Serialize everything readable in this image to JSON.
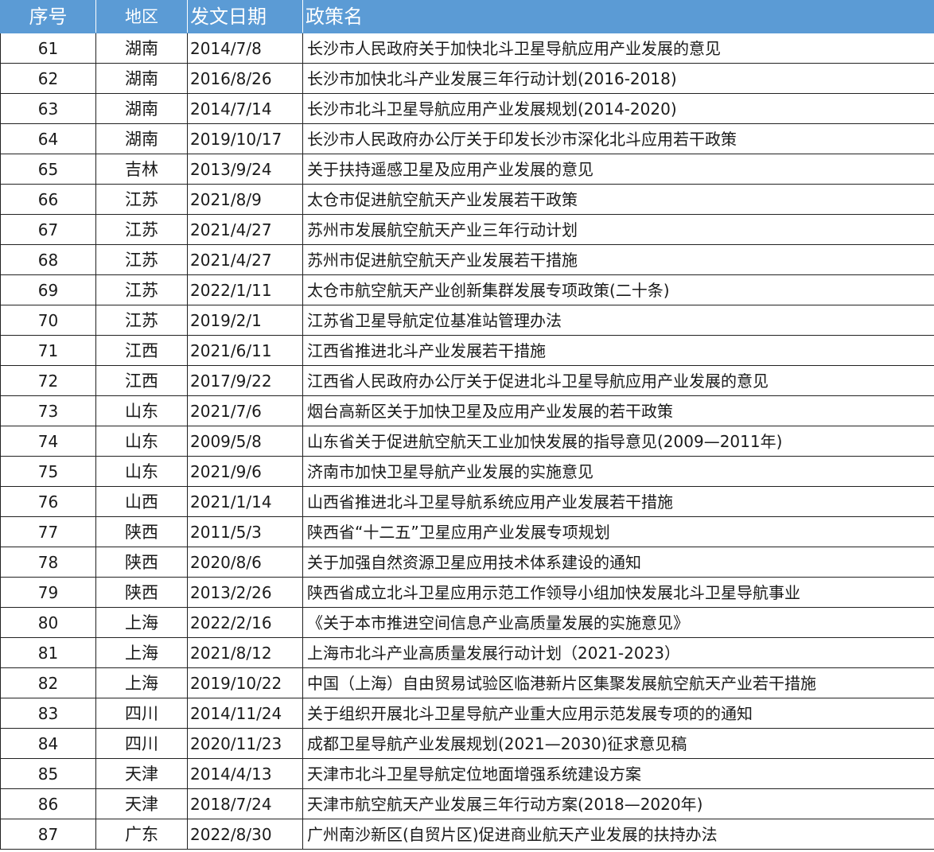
{
  "header": {
    "col_no": "序号",
    "col_region": "地区",
    "col_date": "发文日期",
    "col_name": "政策名"
  },
  "rows": [
    {
      "no": "61",
      "region": "湖南",
      "date": "2014/7/8",
      "name": "长沙市人民政府关于加快北斗卫星导航应用产业发展的意见"
    },
    {
      "no": "62",
      "region": "湖南",
      "date": "2016/8/26",
      "name": "长沙市加快北斗产业发展三年行动计划(2016-2018)"
    },
    {
      "no": "63",
      "region": "湖南",
      "date": "2014/7/14",
      "name": "长沙市北斗卫星导航应用产业发展规划(2014-2020)"
    },
    {
      "no": "64",
      "region": "湖南",
      "date": "2019/10/17",
      "name": "长沙市人民政府办公厅关于印发长沙市深化北斗应用若干政策"
    },
    {
      "no": "65",
      "region": "吉林",
      "date": "2013/9/24",
      "name": "关于扶持遥感卫星及应用产业发展的意见"
    },
    {
      "no": "66",
      "region": "江苏",
      "date": "2021/8/9",
      "name": "太仓市促进航空航天产业发展若干政策"
    },
    {
      "no": "67",
      "region": "江苏",
      "date": "2021/4/27",
      "name": "苏州市发展航空航天产业三年行动计划"
    },
    {
      "no": "68",
      "region": "江苏",
      "date": "2021/4/27",
      "name": "苏州市促进航空航天产业发展若干措施"
    },
    {
      "no": "69",
      "region": "江苏",
      "date": "2022/1/11",
      "name": "太仓市航空航天产业创新集群发展专项政策(二十条)"
    },
    {
      "no": "70",
      "region": "江苏",
      "date": "2019/2/1",
      "name": "江苏省卫星导航定位基准站管理办法"
    },
    {
      "no": "71",
      "region": "江西",
      "date": "2021/6/11",
      "name": "江西省推进北斗产业发展若干措施"
    },
    {
      "no": "72",
      "region": "江西",
      "date": "2017/9/22",
      "name": "江西省人民政府办公厅关于促进北斗卫星导航应用产业发展的意见"
    },
    {
      "no": "73",
      "region": "山东",
      "date": "2021/7/6",
      "name": "烟台高新区关于加快卫星及应用产业发展的若干政策"
    },
    {
      "no": "74",
      "region": "山东",
      "date": "2009/5/8",
      "name": "山东省关于促进航空航天工业加快发展的指导意见(2009—2011年)"
    },
    {
      "no": "75",
      "region": "山东",
      "date": "2021/9/6",
      "name": "济南市加快卫星导航产业发展的实施意见"
    },
    {
      "no": "76",
      "region": "山西",
      "date": "2021/1/14",
      "name": "山西省推进北斗卫星导航系统应用产业发展若干措施"
    },
    {
      "no": "77",
      "region": "陕西",
      "date": "2011/5/3",
      "name": "陕西省“十二五”卫星应用产业发展专项规划"
    },
    {
      "no": "78",
      "region": "陕西",
      "date": "2020/8/6",
      "name": "关于加强自然资源卫星应用技术体系建设的通知"
    },
    {
      "no": "79",
      "region": "陕西",
      "date": "2013/2/26",
      "name": "陕西省成立北斗卫星应用示范工作领导小组加快发展北斗卫星导航事业"
    },
    {
      "no": "80",
      "region": "上海",
      "date": "2022/2/16",
      "name": "《关于本市推进空间信息产业高质量发展的实施意见》"
    },
    {
      "no": "81",
      "region": "上海",
      "date": "2021/8/12",
      "name": "上海市北斗产业高质量发展行动计划（2021-2023）"
    },
    {
      "no": "82",
      "region": "上海",
      "date": "2019/10/22",
      "name": "中国（上海）自由贸易试验区临港新片区集聚发展航空航天产业若干措施"
    },
    {
      "no": "83",
      "region": "四川",
      "date": "2014/11/24",
      "name": "关于组织开展北斗卫星导航产业重大应用示范发展专项的的通知"
    },
    {
      "no": "84",
      "region": "四川",
      "date": "2020/11/23",
      "name": "成都卫星导航产业发展规划(2021—2030)征求意见稿"
    },
    {
      "no": "85",
      "region": "天津",
      "date": "2014/4/13",
      "name": "天津市北斗卫星导航定位地面增强系统建设方案"
    },
    {
      "no": "86",
      "region": "天津",
      "date": "2018/7/24",
      "name": "天津市航空航天产业发展三年行动方案(2018—2020年)"
    },
    {
      "no": "87",
      "region": "广东",
      "date": "2022/8/30",
      "name": "广州南沙新区(自贸片区)促进商业航天产业发展的扶持办法"
    }
  ]
}
